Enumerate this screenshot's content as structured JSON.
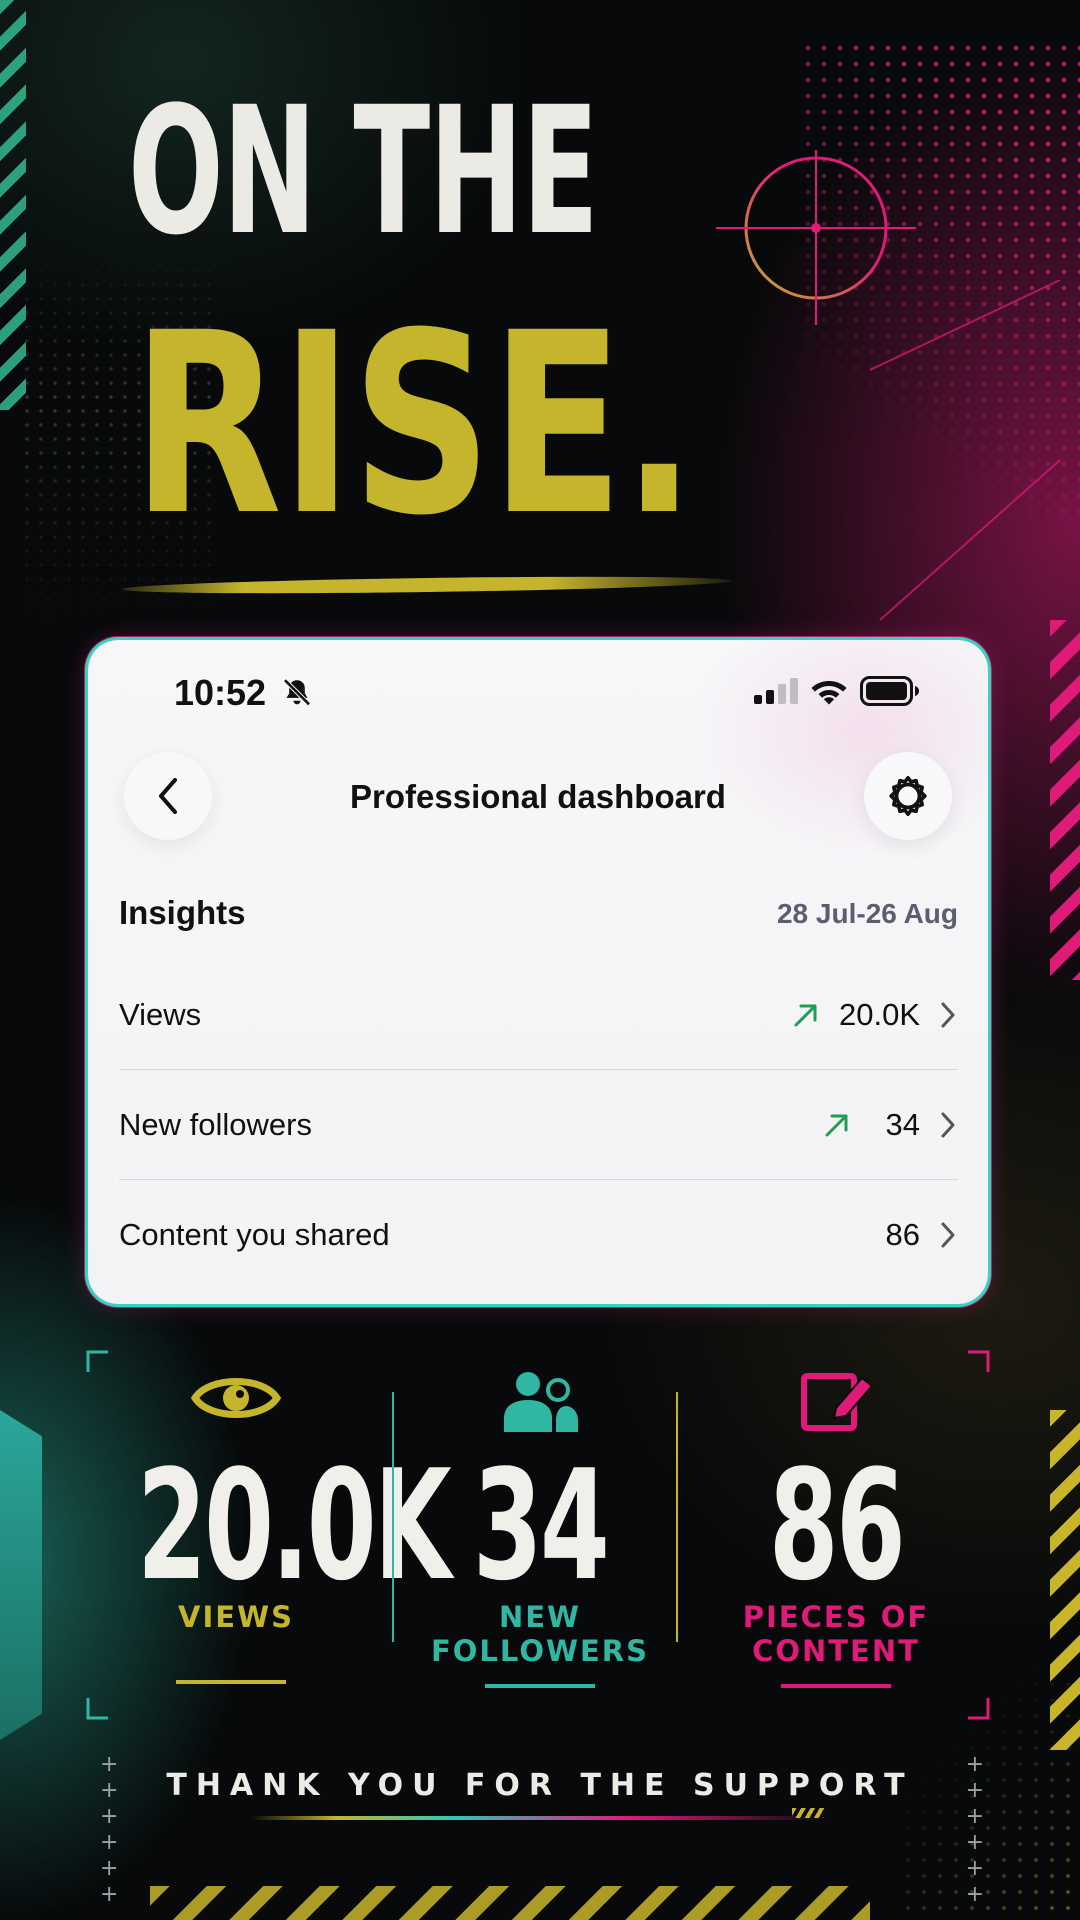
{
  "headline": {
    "line1": "ON THE",
    "line2": "RISE."
  },
  "status_bar": {
    "time": "10:52"
  },
  "nav": {
    "title": "Professional dashboard"
  },
  "insights": {
    "title": "Insights",
    "date_range": "28 Jul-26 Aug",
    "rows": [
      {
        "label": "Views",
        "value": "20.0K",
        "trend": "up"
      },
      {
        "label": "New followers",
        "value": "34",
        "trend": "up"
      },
      {
        "label": "Content you shared",
        "value": "86",
        "trend": "none"
      }
    ]
  },
  "stats": [
    {
      "icon": "eye-icon",
      "value": "20.0K",
      "label": "VIEWS",
      "color": "#c5b52d"
    },
    {
      "icon": "people-icon",
      "value": "34",
      "label_line1": "NEW",
      "label_line2": "FOLLOWERS",
      "color": "#2fb7a4"
    },
    {
      "icon": "edit-icon",
      "value": "86",
      "label_line1": "PIECES OF",
      "label_line2": "CONTENT",
      "color": "#e01a79"
    }
  ],
  "footer": {
    "thanks": "THANK YOU FOR THE SUPPORT"
  },
  "colors": {
    "yellow": "#c5b52d",
    "teal": "#2fb7a4",
    "pink": "#e01a79",
    "trend_green": "#1f9d55"
  }
}
